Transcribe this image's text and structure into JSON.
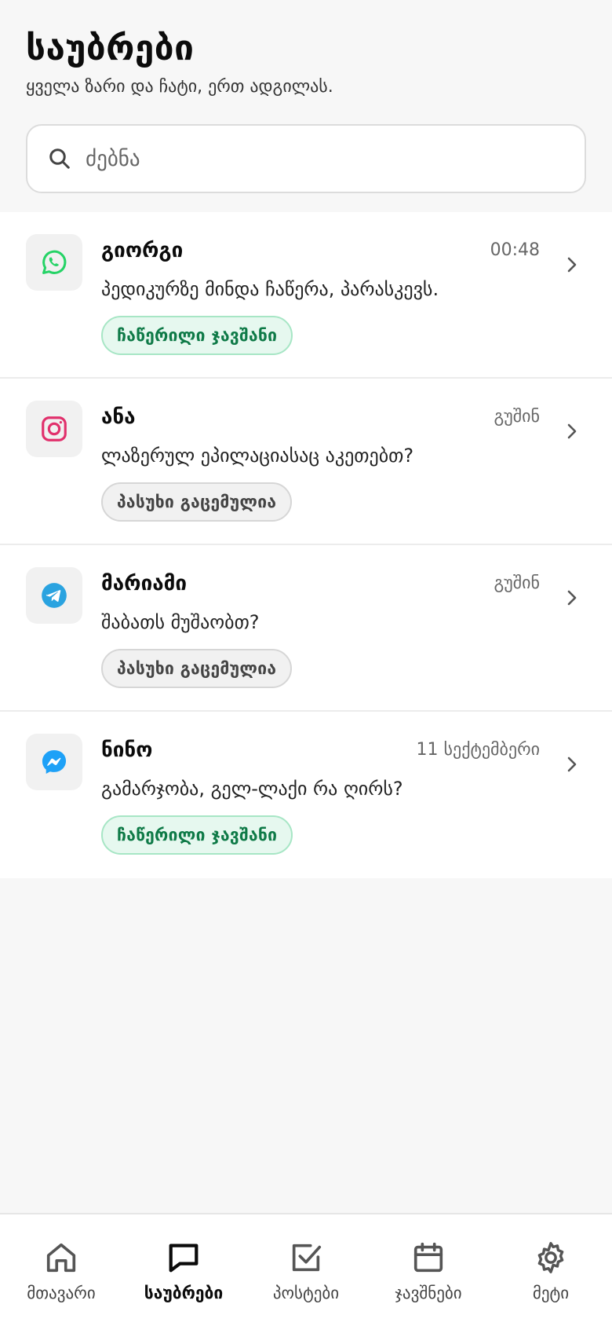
{
  "header": {
    "title": "საუბრები",
    "subtitle": "ყველა ზარი და ჩატი, ერთ ადგილას."
  },
  "search": {
    "placeholder": "ძებნა",
    "icon": "search-icon"
  },
  "conversations": [
    {
      "channel": "whatsapp",
      "icon": "whatsapp-icon",
      "name": "გიორგი",
      "time": "00:48",
      "message": "პედიკურზე მინდა ჩაწერა, პარასკევს.",
      "badge": "ჩაწერილი ჯავშანი",
      "badge_kind": "green"
    },
    {
      "channel": "instagram",
      "icon": "instagram-icon",
      "name": "ანა",
      "time": "გუშინ",
      "message": "ლაზერულ ეპილაციასაც აკეთებთ?",
      "badge": "პასუხი გაცემულია",
      "badge_kind": "gray"
    },
    {
      "channel": "telegram",
      "icon": "telegram-icon",
      "name": "მარიამი",
      "time": "გუშინ",
      "message": "შაბათს მუშაობთ?",
      "badge": "პასუხი გაცემულია",
      "badge_kind": "gray"
    },
    {
      "channel": "messenger",
      "icon": "messenger-icon",
      "name": "ნინო",
      "time": "11 სექტემბერი",
      "message": "გამარჯობა, გელ-ლაქი რა ღირს?",
      "badge": "ჩაწერილი ჯავშანი",
      "badge_kind": "green"
    }
  ],
  "nav": [
    {
      "label": "მთავარი",
      "icon": "home-icon",
      "active": false
    },
    {
      "label": "საუბრები",
      "icon": "chat-icon",
      "active": true
    },
    {
      "label": "პოსტები",
      "icon": "checkbox-icon",
      "active": false
    },
    {
      "label": "ჯავშნები",
      "icon": "calendar-icon",
      "active": false
    },
    {
      "label": "მეტი",
      "icon": "gear-icon",
      "active": false
    }
  ],
  "colors": {
    "whatsapp": "#25d366",
    "instagram": "#e1306c",
    "telegram": "#2aa3e0",
    "messenger": "#1ea1f7",
    "badge_green": "#0e7a47",
    "accent": "#0b0b0b"
  }
}
